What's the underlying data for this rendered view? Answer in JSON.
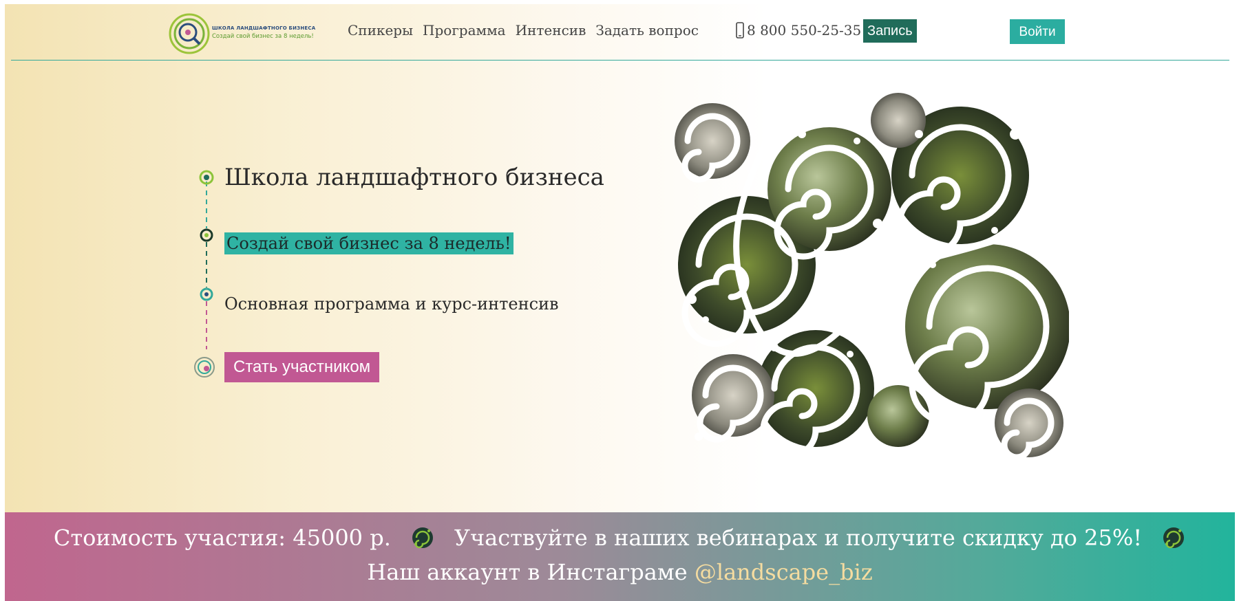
{
  "brand": {
    "title": "ШКОЛА ЛАНДШАФТНОГО БИЗНЕСА",
    "subtitle": "Создай свой бизнес за 8 недель!"
  },
  "nav": {
    "items": [
      {
        "label": "Спикеры"
      },
      {
        "label": "Программа"
      },
      {
        "label": "Интенсив"
      },
      {
        "label": "Задать вопрос"
      }
    ]
  },
  "header": {
    "phone": "8 800 550-25-35",
    "signup_label": "Запись",
    "login_label": "Войти"
  },
  "hero": {
    "title": "Школа ландшафтного бизнеса",
    "subtitle": "Создай свой бизнес за 8 недель!",
    "description": "Основная программа и курс-интенсив",
    "cta_label": "Стать участником"
  },
  "band": {
    "price_text": "Стоимость участия: 45000 р.",
    "discount_text": "Участвуйте в наших вебинарах и получите скидку до 25%!",
    "instagram_prefix": "Наш аккаунт в Инстаграме",
    "instagram_handle": "@landscape_biz"
  },
  "colors": {
    "accent_teal": "#2bada0",
    "dark_green": "#206c5a",
    "magenta": "#c15893",
    "line": "#33a89a"
  }
}
